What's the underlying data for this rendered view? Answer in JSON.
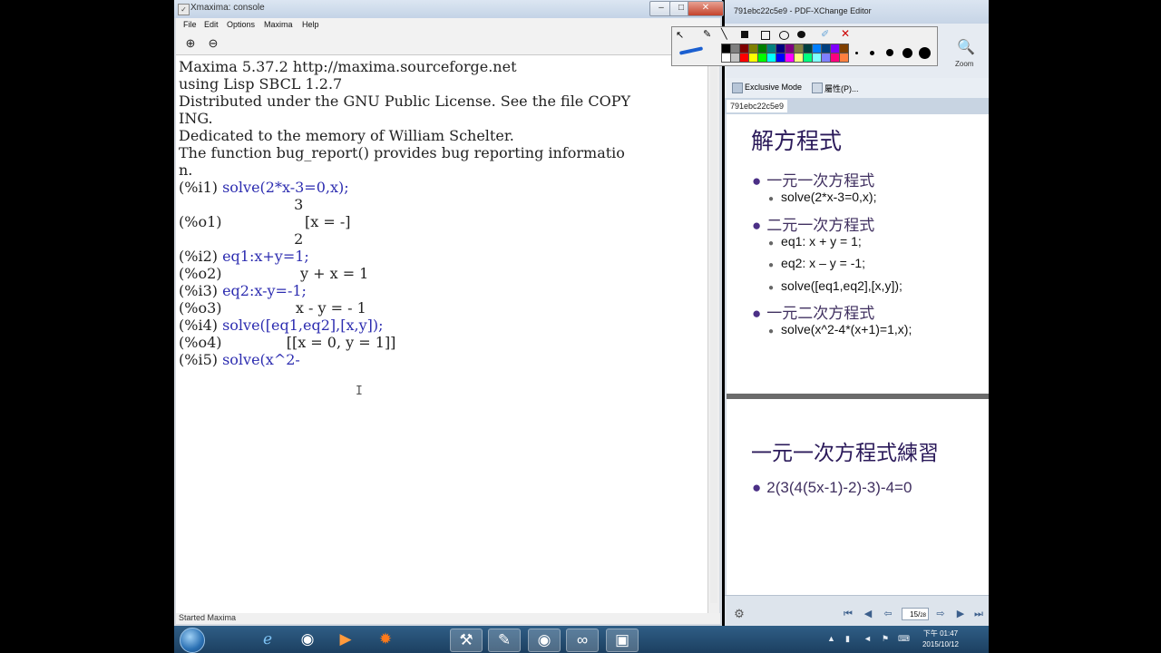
{
  "xmaxima": {
    "title": "Xmaxima: console",
    "menu": [
      "File",
      "Edit",
      "Options",
      "Maxima",
      "Help"
    ],
    "console_lines": [
      {
        "text": "Maxima 5.37.2 http://maxima.sourceforge.net"
      },
      {
        "text": "using Lisp SBCL 1.2.7"
      },
      {
        "text": "Distributed under the GNU Public License. See the file COPY"
      },
      {
        "text": "ING."
      },
      {
        "text": "Dedicated to the memory of William Schelter."
      },
      {
        "text": "The function bug_report() provides bug reporting informatio"
      },
      {
        "text": "n."
      },
      {
        "label": "(%i1) ",
        "input": "solve(2*x-3=0,x);"
      },
      {
        "text": "                         3"
      },
      {
        "label": "(%o1)",
        "text": "                  [x = -]"
      },
      {
        "text": "                         2"
      },
      {
        "label": "(%i2) ",
        "input": "eq1:x+y=1;"
      },
      {
        "label": "(%o2)",
        "text": "                 y + x = 1"
      },
      {
        "label": "(%i3) ",
        "input": "eq2:x-y=-1;"
      },
      {
        "label": "(%o3)",
        "text": "                x - y = - 1"
      },
      {
        "label": "(%i4) ",
        "input": "solve([eq1,eq2],[x,y]);"
      },
      {
        "label": "(%o4)",
        "text": "              [[x = 0, y = 1]]"
      },
      {
        "label": "(%i5) ",
        "input": "solve(x^2-"
      }
    ],
    "status": "Started Maxima"
  },
  "pdf": {
    "title": "791ebc22c5e9 - PDF-XChange Editor",
    "tab": "791ebc22c5e9",
    "ribbon": {
      "zoom_label": "Zoom",
      "exclusive_mode": "Exclusive Mode",
      "properties": "屬性(P)..."
    },
    "slide1": {
      "title": "解方程式",
      "items": [
        {
          "level": 1,
          "text": "一元一次方程式"
        },
        {
          "level": 2,
          "text": "solve(2*x-3=0,x);"
        },
        {
          "level": 1,
          "text": "二元一次方程式"
        },
        {
          "level": 2,
          "text": "eq1: x + y = 1;"
        },
        {
          "level": 2,
          "text": "eq2: x – y = -1;"
        },
        {
          "level": 2,
          "text": "solve([eq1,eq2],[x,y]);"
        },
        {
          "level": 1,
          "text": "一元二次方程式"
        },
        {
          "level": 2,
          "text": "solve(x^2-4*(x+1)=1,x);"
        }
      ]
    },
    "slide2": {
      "title": "一元一次方程式練習",
      "items": [
        {
          "level": 1,
          "text": "2(3(4(5x-1)-2)-3)-4=0"
        }
      ]
    },
    "page_current": "15",
    "page_total": "28"
  },
  "taskbar": {
    "time": "下午 01:47",
    "date": "2015/10/12"
  },
  "colors": {
    "accent": "#2d2db0",
    "slide_title": "#2b1a5a",
    "taskbar": "#1c3f60"
  },
  "icons": [
    "windows-start-icon",
    "ie-icon",
    "chrome-icon",
    "media-player-icon",
    "firefox-icon",
    "tool-icon",
    "pen-icon",
    "chrome-icon-2",
    "maxima-icon",
    "screen-icon"
  ]
}
